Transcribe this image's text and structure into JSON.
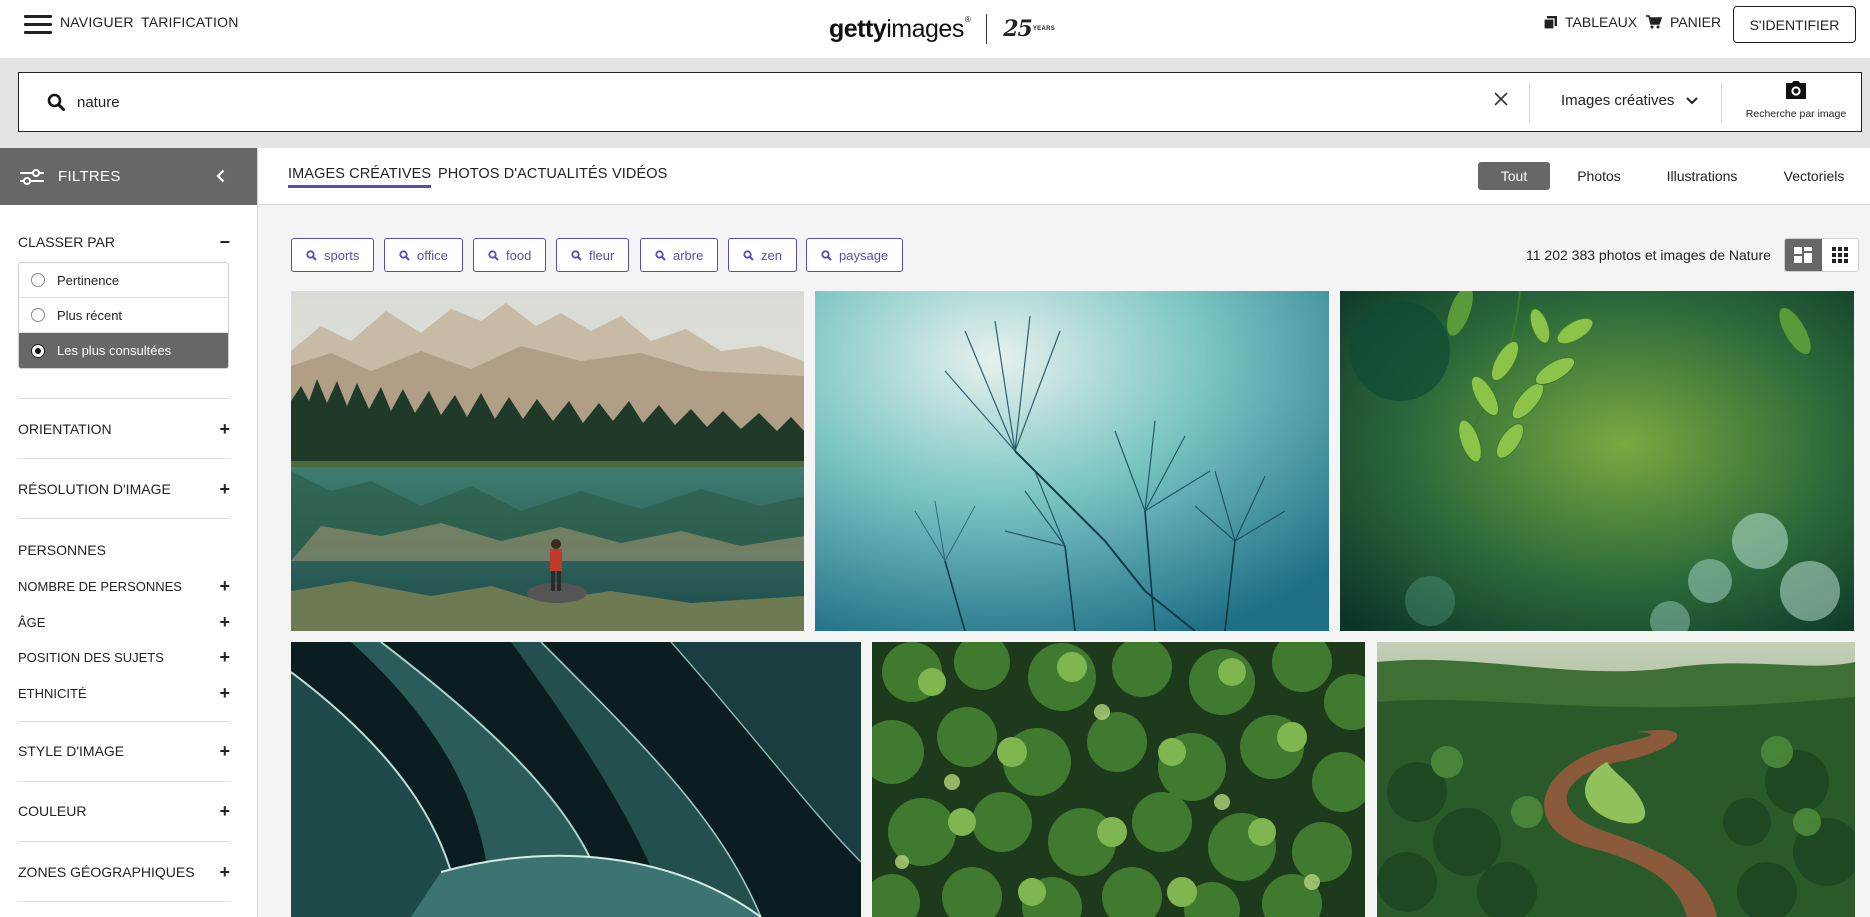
{
  "header": {
    "nav_label": "NAVIGUER",
    "pricing_label": "TARIFICATION",
    "logo_bold": "getty",
    "logo_light": "images",
    "logo_reg": "®",
    "logo_anniv": "25",
    "logo_years": "YEARS",
    "boards_label": "TABLEAUX",
    "cart_label": "PANIER",
    "signin_label": "S'IDENTIFIER"
  },
  "search": {
    "query": "nature",
    "type_label": "Images créatives",
    "image_search_label": "Recherche par image"
  },
  "sidebar": {
    "filters_label": "FILTRES",
    "sort_title": "CLASSER PAR",
    "sort_options": [
      {
        "label": "Pertinence"
      },
      {
        "label": "Plus récent"
      },
      {
        "label": "Les plus consultées"
      }
    ],
    "sections": {
      "orientation": "ORIENTATION",
      "resolution": "RÉSOLUTION D'IMAGE",
      "people": "PERSONNES",
      "people_count": "NOMBRE DE PERSONNES",
      "age": "ÂGE",
      "position": "POSITION DES SUJETS",
      "ethnicity": "ETHNICITÉ",
      "style": "STYLE D'IMAGE",
      "color": "COULEUR",
      "geo": "ZONES GÉOGRAPHIQUES"
    }
  },
  "tabs": {
    "creative": "IMAGES CRÉATIVES",
    "editorial": "PHOTOS D'ACTUALITÉS",
    "videos": "VIDÉOS"
  },
  "asset_types": {
    "all": "Tout",
    "photos": "Photos",
    "illustrations": "Illustrations",
    "vectors": "Vectoriels"
  },
  "chips": [
    "sports",
    "office",
    "food",
    "fleur",
    "arbre",
    "zen",
    "paysage"
  ],
  "results": {
    "count_text": "11 202 383 photos et images de Nature"
  },
  "colors": {
    "accent": "#5a4bb3",
    "sidebar_header": "#676767"
  }
}
